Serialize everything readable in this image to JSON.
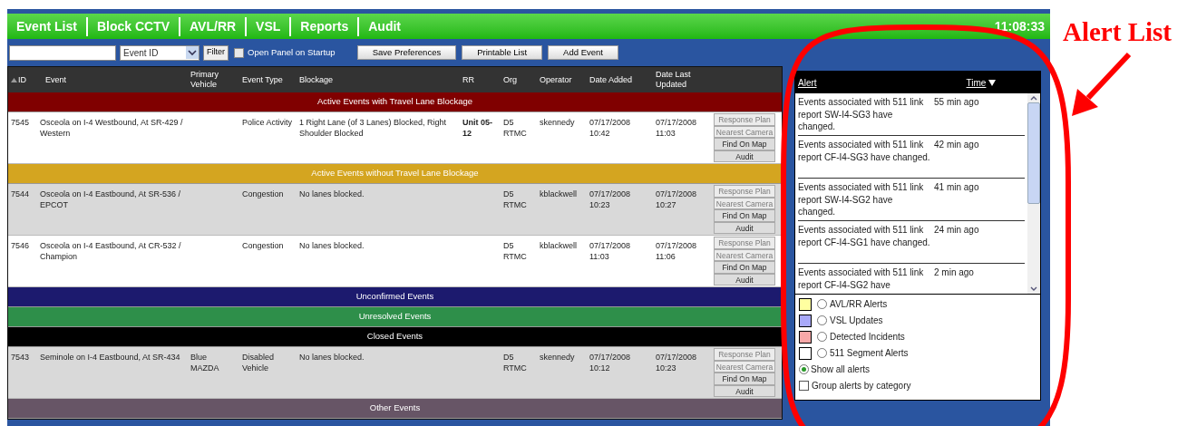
{
  "nav": {
    "tabs": [
      {
        "label": "Event List"
      },
      {
        "label": "Block CCTV"
      },
      {
        "label": "AVL/RR"
      },
      {
        "label": "VSL"
      },
      {
        "label": "Reports"
      },
      {
        "label": "Audit"
      }
    ],
    "clock": "11:08:33"
  },
  "toolbar": {
    "select": "Event ID",
    "filter": "Filter",
    "checkbox": {
      "label": "Open Panel on Startup",
      "checked": false
    },
    "buttons": [
      "Save Preferences",
      "Printable List",
      "Add Event"
    ]
  },
  "table": {
    "columns": [
      "ID",
      "Event",
      "Primary Vehicle",
      "Event Type",
      "Blockage",
      "RR",
      "Org",
      "Operator",
      "Date Added",
      "Date Last Updated"
    ],
    "sections": [
      {
        "title": "Active Events with Travel Lane Blockage",
        "color": "#800000",
        "rows": [
          {
            "id": "7545",
            "event": "Osceola on I-4 Westbound, At SR-429 / Western",
            "event_type": "Police Activity",
            "blockage": "1 Right Lane (of 3 Lanes) Blocked, Right Shoulder Blocked",
            "rr": "Unit 05-12",
            "org": "D5 RTMC",
            "operator": "skennedy",
            "date_added": "07/17/2008 10:42",
            "date_updated": "07/17/2008 11:03",
            "actions": [
              {
                "label": "Response Plan",
                "disabled": true
              },
              {
                "label": "Nearest Camera",
                "disabled": true
              },
              {
                "label": "Find On Map",
                "disabled": false
              },
              {
                "label": "Audit",
                "disabled": false
              }
            ]
          }
        ]
      },
      {
        "title": "Active Events without Travel Lane Blockage",
        "color": "#d4a520",
        "rows": [
          {
            "id": "7544",
            "event": "Osceola on I-4 Eastbound, At SR-536 / EPCOT",
            "event_type": "Congestion",
            "blockage": "No lanes blocked.",
            "org": "D5 RTMC",
            "operator": "kblackwell",
            "date_added": "07/17/2008 10:23",
            "date_updated": "07/17/2008 10:27",
            "actions": [
              {
                "label": "Response Plan",
                "disabled": true
              },
              {
                "label": "Nearest Camera",
                "disabled": true
              },
              {
                "label": "Find On Map",
                "disabled": false
              },
              {
                "label": "Audit",
                "disabled": false
              }
            ]
          },
          {
            "id": "7546",
            "event": "Osceola on I-4 Eastbound, At CR-532 / Champion",
            "event_type": "Congestion",
            "blockage": "No lanes blocked.",
            "org": "D5 RTMC",
            "operator": "kblackwell",
            "date_added": "07/17/2008 11:03",
            "date_updated": "07/17/2008 11:06",
            "actions": [
              {
                "label": "Response Plan",
                "disabled": true
              },
              {
                "label": "Nearest Camera",
                "disabled": true
              },
              {
                "label": "Find On Map",
                "disabled": false
              },
              {
                "label": "Audit",
                "disabled": false
              }
            ]
          }
        ]
      },
      {
        "title": "Unconfirmed Events",
        "color": "#1c1a6e"
      },
      {
        "title": "Unresolved Events",
        "color": "#2e8f4a"
      },
      {
        "title": "Closed Events",
        "color": "#000000",
        "rows": [
          {
            "id": "7543",
            "event": "Seminole on I-4 Eastbound, At SR-434",
            "primary_vehicle": "Blue MAZDA",
            "event_type": "Disabled Vehicle",
            "blockage": "No lanes blocked.",
            "org": "D5 RTMC",
            "operator": "skennedy",
            "date_added": "07/17/2008 10:12",
            "date_updated": "07/17/2008 10:23",
            "actions": [
              {
                "label": "Response Plan",
                "disabled": true
              },
              {
                "label": "Nearest Camera",
                "disabled": true
              },
              {
                "label": "Find On Map",
                "disabled": false
              },
              {
                "label": "Audit",
                "disabled": false
              }
            ]
          }
        ]
      },
      {
        "title": "Other Events",
        "color": "#675566"
      }
    ]
  },
  "alert_panel": {
    "alert_header": "Alert",
    "time_header": "Time",
    "alerts": [
      {
        "text": "Events associated with 511 link report SW-I4-SG3 have changed.",
        "time": "55 min ago"
      },
      {
        "text": "Events associated with 511 link report CF-I4-SG3 have changed.",
        "time": "42 min ago"
      },
      {
        "text": "Events associated with 511 link report SW-I4-SG2 have changed.",
        "time": "41 min ago"
      },
      {
        "text": "Events associated with 511 link report CF-I4-SG1 have changed.",
        "time": "24 min ago"
      },
      {
        "text": "Events associated with 511 link report CF-I4-SG2 have",
        "time": "2 min ago"
      }
    ],
    "categories": [
      {
        "label": "AVL/RR Alerts",
        "color": "#ffffa0",
        "selected": false
      },
      {
        "label": "VSL Updates",
        "color": "#a8a8f8",
        "selected": false
      },
      {
        "label": "Detected Incidents",
        "color": "#f8a8a8",
        "selected": false
      },
      {
        "label": "511 Segment Alerts",
        "color": "#ffffff",
        "selected": false
      }
    ],
    "show_all": {
      "label": "Show all alerts",
      "selected": true
    },
    "group": {
      "label": "Group alerts by category",
      "checked": false
    }
  },
  "annotation": {
    "label": "Alert List"
  }
}
